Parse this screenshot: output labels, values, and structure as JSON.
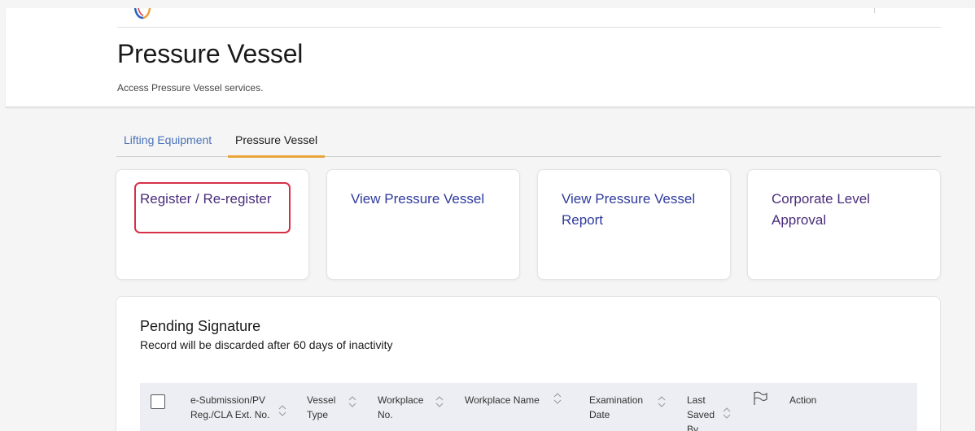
{
  "header": {
    "title": "Pressure Vessel",
    "subtitle": "Access Pressure Vessel services."
  },
  "tabs": [
    {
      "label": "Lifting Equipment",
      "active": false
    },
    {
      "label": "Pressure Vessel",
      "active": true
    }
  ],
  "cards": [
    {
      "label": "Register / Re-register",
      "highlighted": true
    },
    {
      "label": "View Pressure Vessel",
      "highlighted": false
    },
    {
      "label": "View Pressure Vessel Report",
      "highlighted": false
    },
    {
      "label": "Corporate Level Approval",
      "highlighted": false
    }
  ],
  "pending": {
    "title": "Pending Signature",
    "note": "Record will be discarded after 60 days of inactivity",
    "columns": {
      "submission": "e-Submission/PV Reg./CLA Ext. No.",
      "vessel_type": "Vessel Type",
      "workplace_no": "Workplace No.",
      "workplace_name": "Workplace Name",
      "exam_date": "Examination Date",
      "last_saved": "Last Saved By",
      "action": "Action"
    }
  },
  "colors": {
    "accent_tab": "#e9a53a",
    "highlight_border": "#d63046",
    "card_link": "#2e3a9c"
  },
  "icons": {
    "flag": "flag-icon",
    "sort": "sort-icon",
    "logo": "logo-icon"
  }
}
